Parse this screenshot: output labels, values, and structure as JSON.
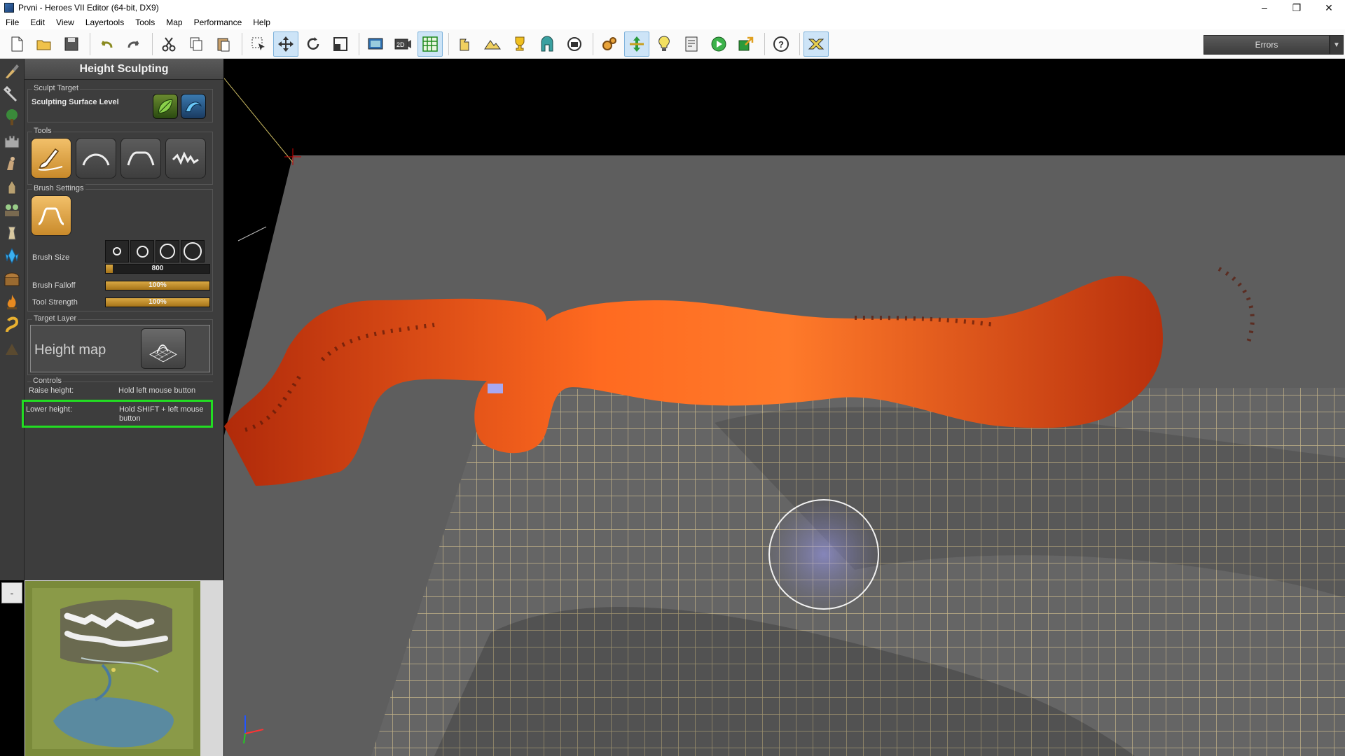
{
  "window": {
    "title": "Prvni - Heroes VII Editor (64-bit, DX9)",
    "minimize": "–",
    "restore": "❐",
    "close": "✕"
  },
  "menu": [
    "File",
    "Edit",
    "View",
    "Layertools",
    "Tools",
    "Map",
    "Performance",
    "Help"
  ],
  "toolbar": {
    "errors_label": "Errors",
    "errors_dropdown": "▼",
    "buttons": [
      "new",
      "open",
      "save",
      "undo",
      "redo",
      "cut",
      "copy",
      "paste",
      "select",
      "move",
      "rotate",
      "scale",
      "screenshot",
      "2d-view",
      "grid",
      "place",
      "terrain",
      "trophy",
      "gate",
      "camera",
      "settings",
      "height",
      "light",
      "script",
      "play",
      "export",
      "help",
      "fx"
    ]
  },
  "panel": {
    "title": "Height Sculpting",
    "sculpt_target": {
      "label": "Sculpt Target",
      "value": "Sculpting Surface Level"
    },
    "tools_label": "Tools",
    "brush_settings": {
      "label": "Brush Settings",
      "brush_size_label": "Brush Size",
      "brush_size_value": "800",
      "brush_size_fraction": 0.07,
      "brush_falloff_label": "Brush Falloff",
      "brush_falloff_value": "100%",
      "brush_falloff_fraction": 1.0,
      "tool_strength_label": "Tool Strength",
      "tool_strength_value": "100%",
      "tool_strength_fraction": 1.0
    },
    "target_layer": {
      "label": "Target Layer",
      "value": "Height map"
    },
    "controls": {
      "label": "Controls",
      "raise_label": "Raise height:",
      "raise_value": "Hold left mouse button",
      "lower_label": "Lower height:",
      "lower_value_1": "Hold SHIFT + left mouse",
      "lower_value_2": "button"
    }
  },
  "minimap": {
    "collapse": "-"
  },
  "colors": {
    "highlight": "#22dd22",
    "accent": "#c98a2a",
    "lava": "#e84d14",
    "grid": "#c9b98a"
  }
}
